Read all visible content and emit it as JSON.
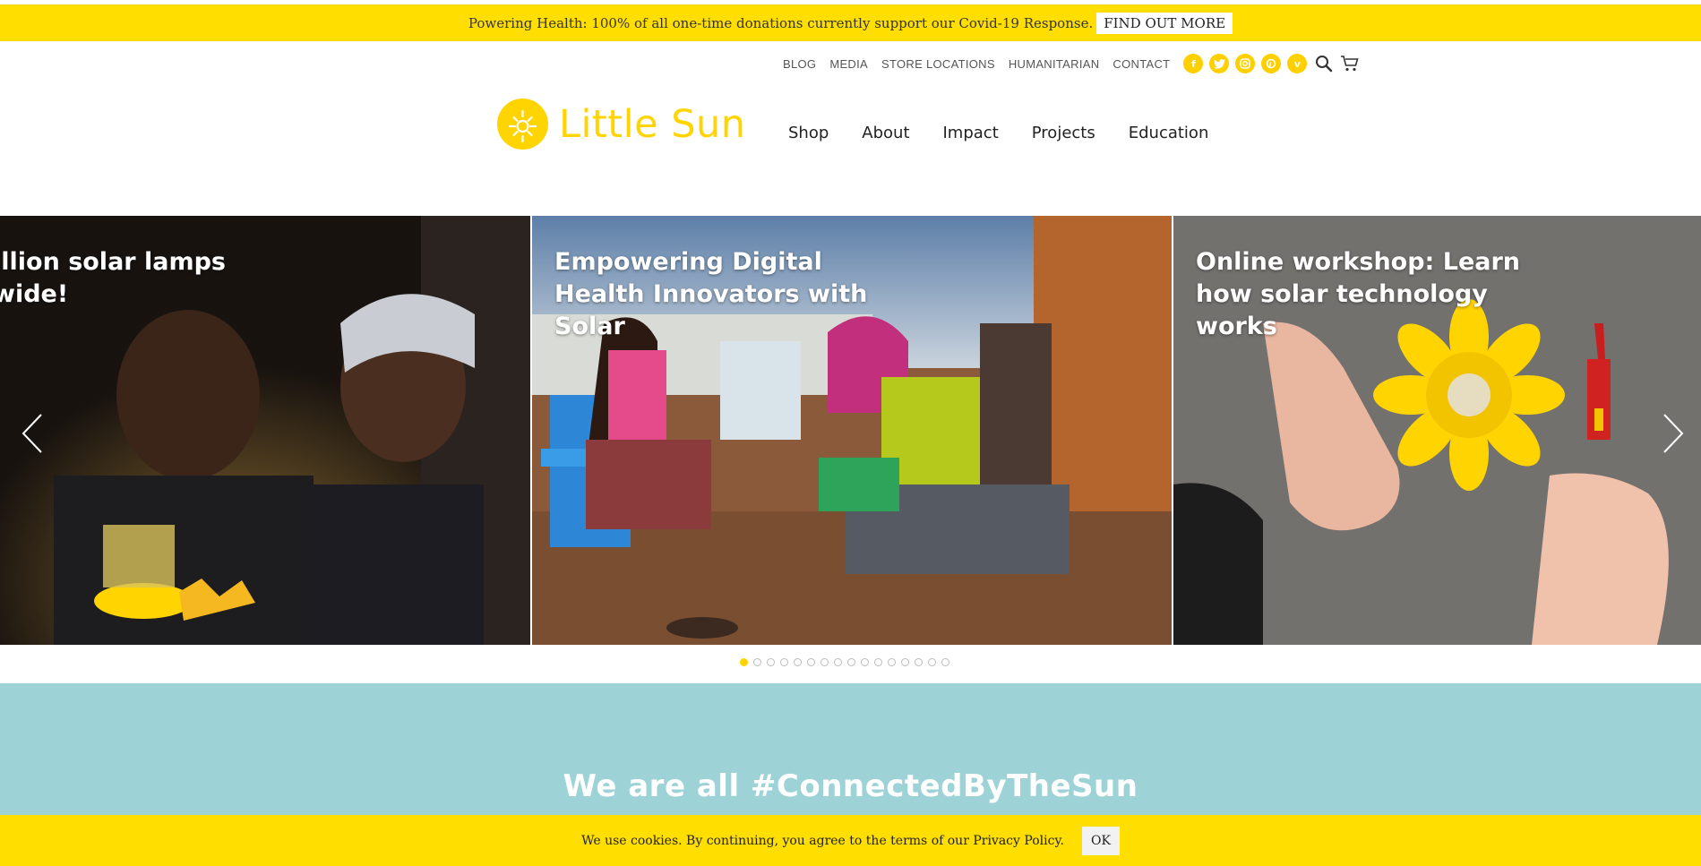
{
  "announcement": {
    "text": "Powering Health: 100% of all one-time donations currently support our Covid-19 Response.",
    "button": "FIND OUT MORE"
  },
  "utility_nav": [
    "BLOG",
    "MEDIA",
    "STORE LOCATIONS",
    "HUMANITARIAN",
    "CONTACT"
  ],
  "social_icons": [
    "facebook-icon",
    "twitter-icon",
    "instagram-icon",
    "pinterest-icon",
    "vimeo-icon"
  ],
  "tools": [
    "search-icon",
    "cart-icon"
  ],
  "brand": {
    "name": "Little Sun",
    "color": "#ffd400"
  },
  "main_nav": [
    "Shop",
    "About",
    "Impact",
    "Projects",
    "Education"
  ],
  "slides": [
    {
      "title": "illion solar lamps\nwide!"
    },
    {
      "title": "Empowering Digital\nHealth Innovators with\nSolar"
    },
    {
      "title": "Online workshop: Learn\nhow solar technology\nworks"
    }
  ],
  "carousel": {
    "dot_count": 16,
    "active_index": 0
  },
  "connected": {
    "heading": "We are all #ConnectedByTheSun"
  },
  "cookie": {
    "text": "We use cookies. By continuing, you agree to the terms of our Privacy Policy.",
    "button": "OK"
  },
  "colors": {
    "accent_yellow": "#ffde00",
    "teal": "#9dd3d6"
  }
}
